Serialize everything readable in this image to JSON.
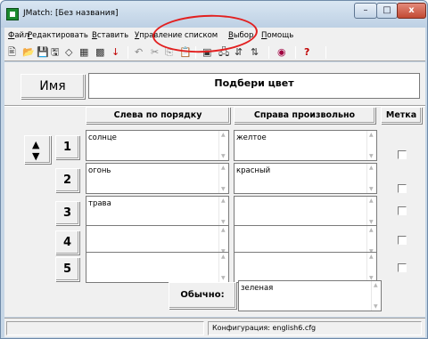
{
  "window": {
    "title": "JMatch: [Без названия]",
    "controls": {
      "minimize": "–",
      "maximize": "□",
      "close": "x"
    }
  },
  "menu": {
    "items": [
      "Файл",
      "Редактировать",
      "Вставить",
      "Управление списком",
      "Выбор",
      "Помощь"
    ]
  },
  "toolbar": {
    "icons": [
      "new-file-icon",
      "open-folder-icon",
      "save-icon",
      "save-as-icon",
      "eraser-icon",
      "grid-icon",
      "grid-options-icon",
      "down-arrow-icon",
      "undo-icon",
      "cut-icon",
      "copy-icon",
      "paste-icon",
      "export-html-icon",
      "export-web-icon",
      "export-drag-icon",
      "export-drop-icon",
      "config-icon",
      "help-icon"
    ],
    "glyphs": [
      "🖹",
      "📂",
      "💾",
      "🖫",
      "◇",
      "▦",
      "▩",
      "↓",
      "↶",
      "✂",
      "⎘",
      "📋",
      "▣",
      "🖧",
      "⇵",
      "⇅",
      "◉",
      "?"
    ]
  },
  "form": {
    "name_label": "Имя",
    "title_value": "Подбери цвет",
    "columns": {
      "left": "Слева по порядку",
      "right": "Справа произвольно",
      "flag": "Метка"
    },
    "rows": [
      {
        "num": "1",
        "left": "солнце",
        "right": "желтое",
        "flag": false
      },
      {
        "num": "2",
        "left": "огонь",
        "right": "красный",
        "flag": false
      },
      {
        "num": "3",
        "left": "трава",
        "right": "",
        "flag": false
      },
      {
        "num": "4",
        "left": "",
        "right": "",
        "flag": false
      },
      {
        "num": "5",
        "left": "",
        "right": "",
        "flag": false
      }
    ],
    "distractor_label": "Обычно:",
    "distractor_value": "зеленая"
  },
  "status": {
    "config": "Конфигурация: english6.cfg"
  },
  "colors": {
    "annotation": "#e22020",
    "title_bar": "#c6d6e6",
    "close_button": "#c24a33"
  }
}
